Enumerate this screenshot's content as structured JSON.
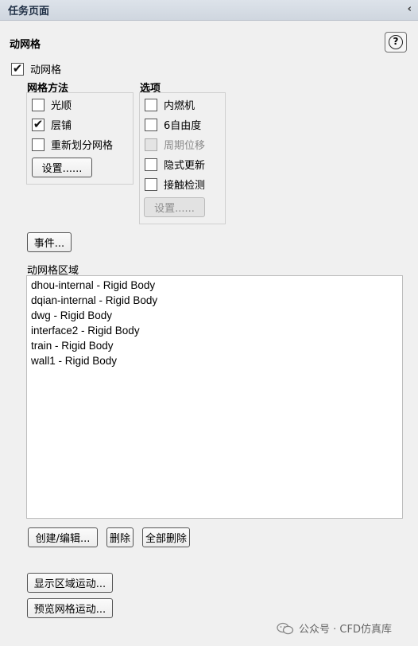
{
  "window": {
    "title": "任务页面"
  },
  "panel": {
    "title": "动网格"
  },
  "enable": {
    "label": "动网格",
    "checked": true
  },
  "mesh_methods": {
    "title": "网格方法",
    "items": [
      {
        "label": "光顺",
        "checked": false
      },
      {
        "label": "层铺",
        "checked": true
      },
      {
        "label": "重新划分网格",
        "checked": false
      }
    ],
    "settings_label": "设置......"
  },
  "options": {
    "title": "选项",
    "items": [
      {
        "label": "内燃机",
        "checked": false,
        "enabled": true
      },
      {
        "label": "6自由度",
        "checked": false,
        "enabled": true
      },
      {
        "label": "周期位移",
        "checked": false,
        "enabled": false
      },
      {
        "label": "隐式更新",
        "checked": false,
        "enabled": true
      },
      {
        "label": "接触检测",
        "checked": false,
        "enabled": true
      }
    ],
    "settings_label": "设置......"
  },
  "events_label": "事件...",
  "zones": {
    "title": "动网格区域",
    "items": [
      "dhou-internal - Rigid Body",
      "dqian-internal - Rigid Body",
      "dwg - Rigid Body",
      "interface2 - Rigid Body",
      "train - Rigid Body",
      "wall1 - Rigid Body"
    ]
  },
  "actions": {
    "create_edit": "创建/编辑...",
    "delete": "删除",
    "delete_all": "全部删除"
  },
  "display": {
    "zone_motion": "显示区域运动...",
    "preview_mesh": "预览网格运动..."
  },
  "watermark": {
    "text": "公众号 · CFD仿真库"
  },
  "icons": {
    "collapse": "chevron-left-icon",
    "help": "help-icon",
    "check": "checkmark-icon"
  }
}
